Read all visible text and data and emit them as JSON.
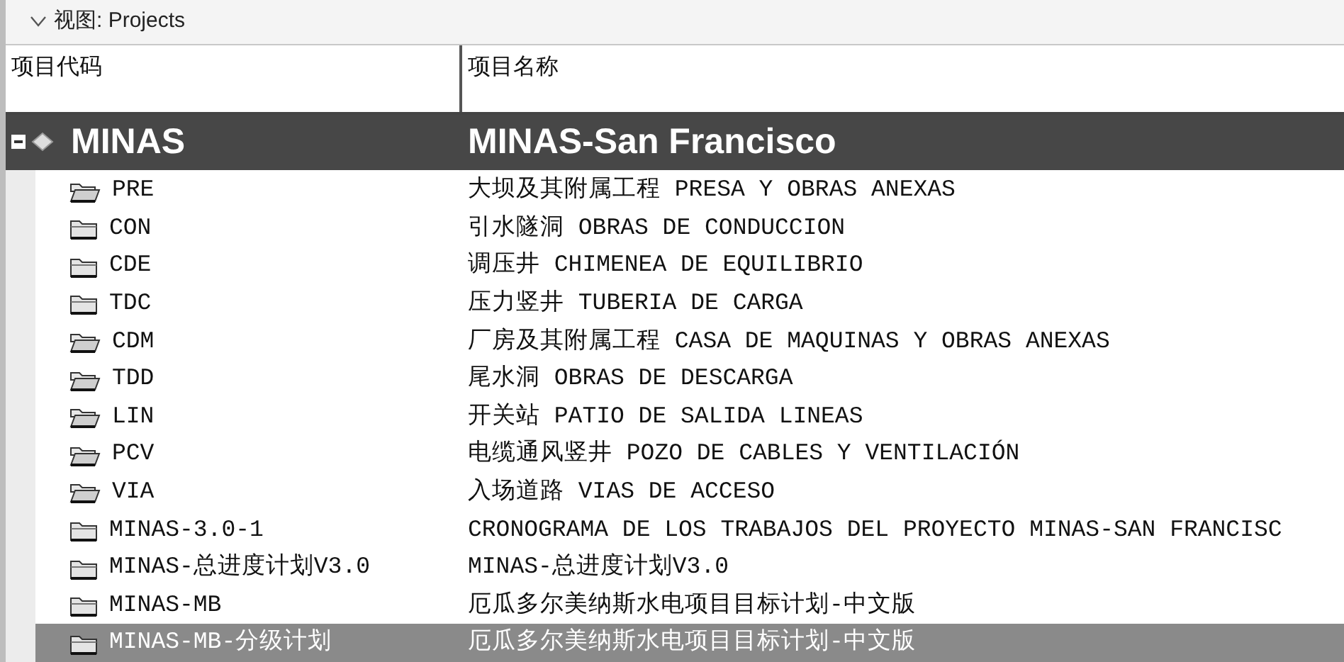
{
  "view_bar": {
    "label": "视图: Projects",
    "expanded": true
  },
  "columns": [
    "项目代码",
    "项目名称"
  ],
  "group": {
    "code": "MINAS",
    "name": "MINAS-San Francisco",
    "expanded": true
  },
  "rows": [
    {
      "code": "PRE",
      "name": "大坝及其附属工程 PRESA Y OBRAS ANEXAS",
      "kind": "open",
      "selected": false
    },
    {
      "code": "CON",
      "name": "引水隧洞 OBRAS DE CONDUCCION",
      "kind": "closed",
      "selected": false
    },
    {
      "code": "CDE",
      "name": "调压井 CHIMENEA DE EQUILIBRIO",
      "kind": "closed",
      "selected": false
    },
    {
      "code": "TDC",
      "name": "压力竖井 TUBERIA DE CARGA",
      "kind": "closed",
      "selected": false
    },
    {
      "code": "CDM",
      "name": "厂房及其附属工程 CASA DE MAQUINAS Y OBRAS ANEXAS",
      "kind": "open",
      "selected": false
    },
    {
      "code": "TDD",
      "name": "尾水洞 OBRAS DE DESCARGA",
      "kind": "open",
      "selected": false
    },
    {
      "code": "LIN",
      "name": "开关站 PATIO DE SALIDA LINEAS",
      "kind": "open",
      "selected": false
    },
    {
      "code": "PCV",
      "name": "电缆通风竖井 POZO DE CABLES Y VENTILACIÓN",
      "kind": "open",
      "selected": false
    },
    {
      "code": "VIA",
      "name": "入场道路 VIAS DE ACCESO",
      "kind": "open",
      "selected": false
    },
    {
      "code": "MINAS-3.0-1",
      "name": "CRONOGRAMA DE LOS TRABAJOS DEL PROYECTO MINAS-SAN FRANCISC",
      "kind": "closed",
      "selected": false
    },
    {
      "code": "MINAS-总进度计划V3.0",
      "name": "MINAS-总进度计划V3.0",
      "kind": "closed",
      "selected": false
    },
    {
      "code": "MINAS-MB",
      "name": "厄瓜多尔美纳斯水电项目目标计划-中文版",
      "kind": "closed",
      "selected": false
    },
    {
      "code": "MINAS-MB-分级计划",
      "name": "厄瓜多尔美纳斯水电项目目标计划-中文版",
      "kind": "closed",
      "selected": true
    }
  ]
}
